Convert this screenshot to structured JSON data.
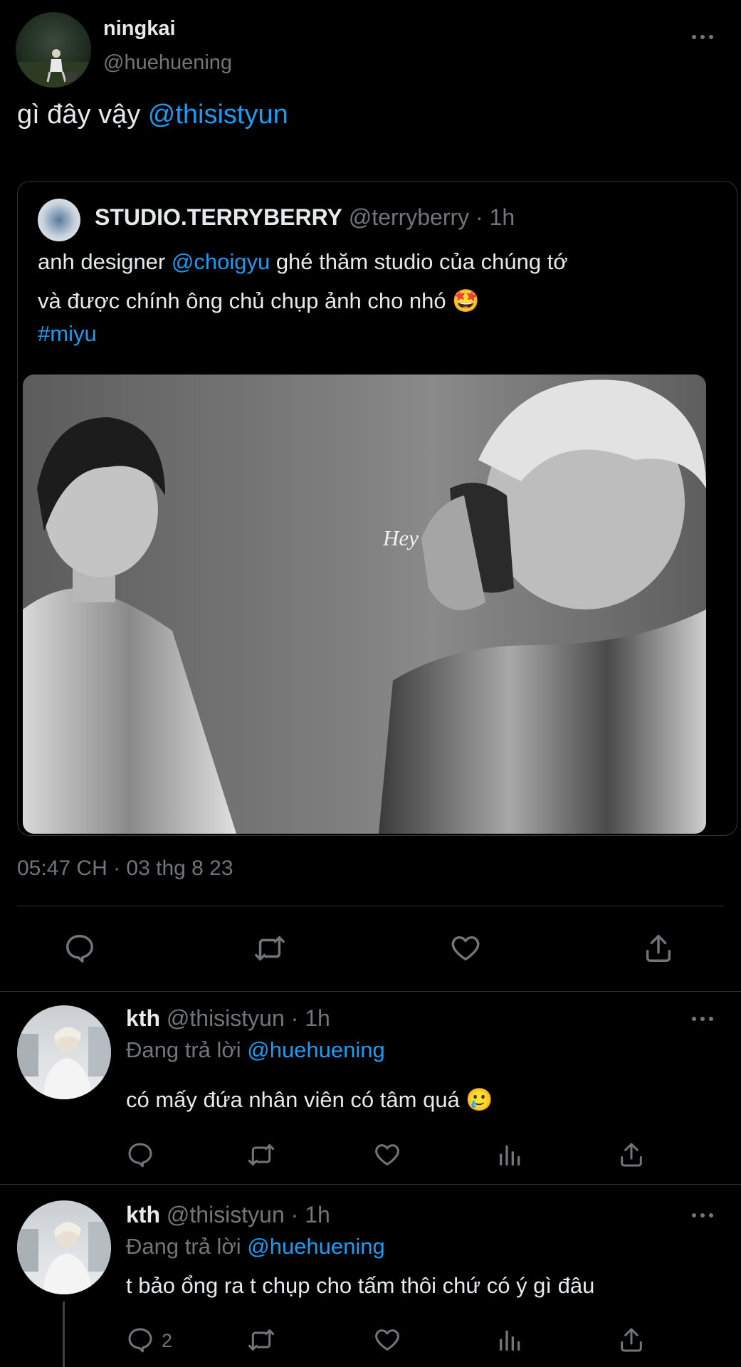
{
  "main_tweet": {
    "display_name": "ningkai",
    "handle": "@huehuening",
    "text_prefix": "gì đây vậy ",
    "mention": "@thisistyun",
    "timestamp": "05:47 CH · 03 thg 8 23"
  },
  "quoted_tweet": {
    "display_name": "STUDIO.TERRYBERRY",
    "handle_time": "@terryberry · 1h",
    "line1_prefix": "anh designer ",
    "line1_mention": "@choigyu",
    "line1_suffix": " ghé thăm studio của chúng tớ",
    "line2": "và được chính ông chủ chụp ảnh cho nhó 🤩",
    "hashtag": "#miyu",
    "image_caption": "Hey"
  },
  "replies": [
    {
      "display_name": "kth",
      "handle_time": "@thisistyun · 1h",
      "replying_prefix": "Đang trả lời ",
      "replying_to": "@huehuening",
      "text": "có mấy đứa nhân viên có tâm quá 🥲",
      "reply_count": ""
    },
    {
      "display_name": "kth",
      "handle_time": "@thisistyun · 1h",
      "replying_prefix": "Đang trả lời ",
      "replying_to": "@huehuening",
      "text": "t bảo ổng ra t chụp cho tấm thôi chứ có ý gì đâu",
      "reply_count": "2"
    }
  ],
  "icons": {
    "more": "more-icon",
    "reply": "reply-icon",
    "retweet": "retweet-icon",
    "like": "like-icon",
    "views": "views-icon",
    "share": "share-icon"
  },
  "colors": {
    "background": "#000000",
    "text": "#e7e9ea",
    "link": "#1d9bf0",
    "muted": "#71767b",
    "divider": "#2f3336"
  }
}
